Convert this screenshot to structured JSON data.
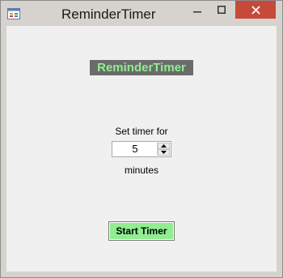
{
  "window": {
    "title": "ReminderTimer"
  },
  "content": {
    "heading": "ReminderTimer",
    "set_timer_label": "Set timer for",
    "timer_value": "5",
    "minutes_label": "minutes",
    "start_button_label": "Start Timer"
  },
  "colors": {
    "heading_bg": "#6b6b6b",
    "heading_text": "#90ee90",
    "start_button_bg": "#90ee90",
    "close_button_bg": "#c7493a"
  },
  "icons": [
    "app-icon",
    "minimize-icon",
    "maximize-icon",
    "close-icon",
    "spin-up-icon",
    "spin-down-icon"
  ]
}
